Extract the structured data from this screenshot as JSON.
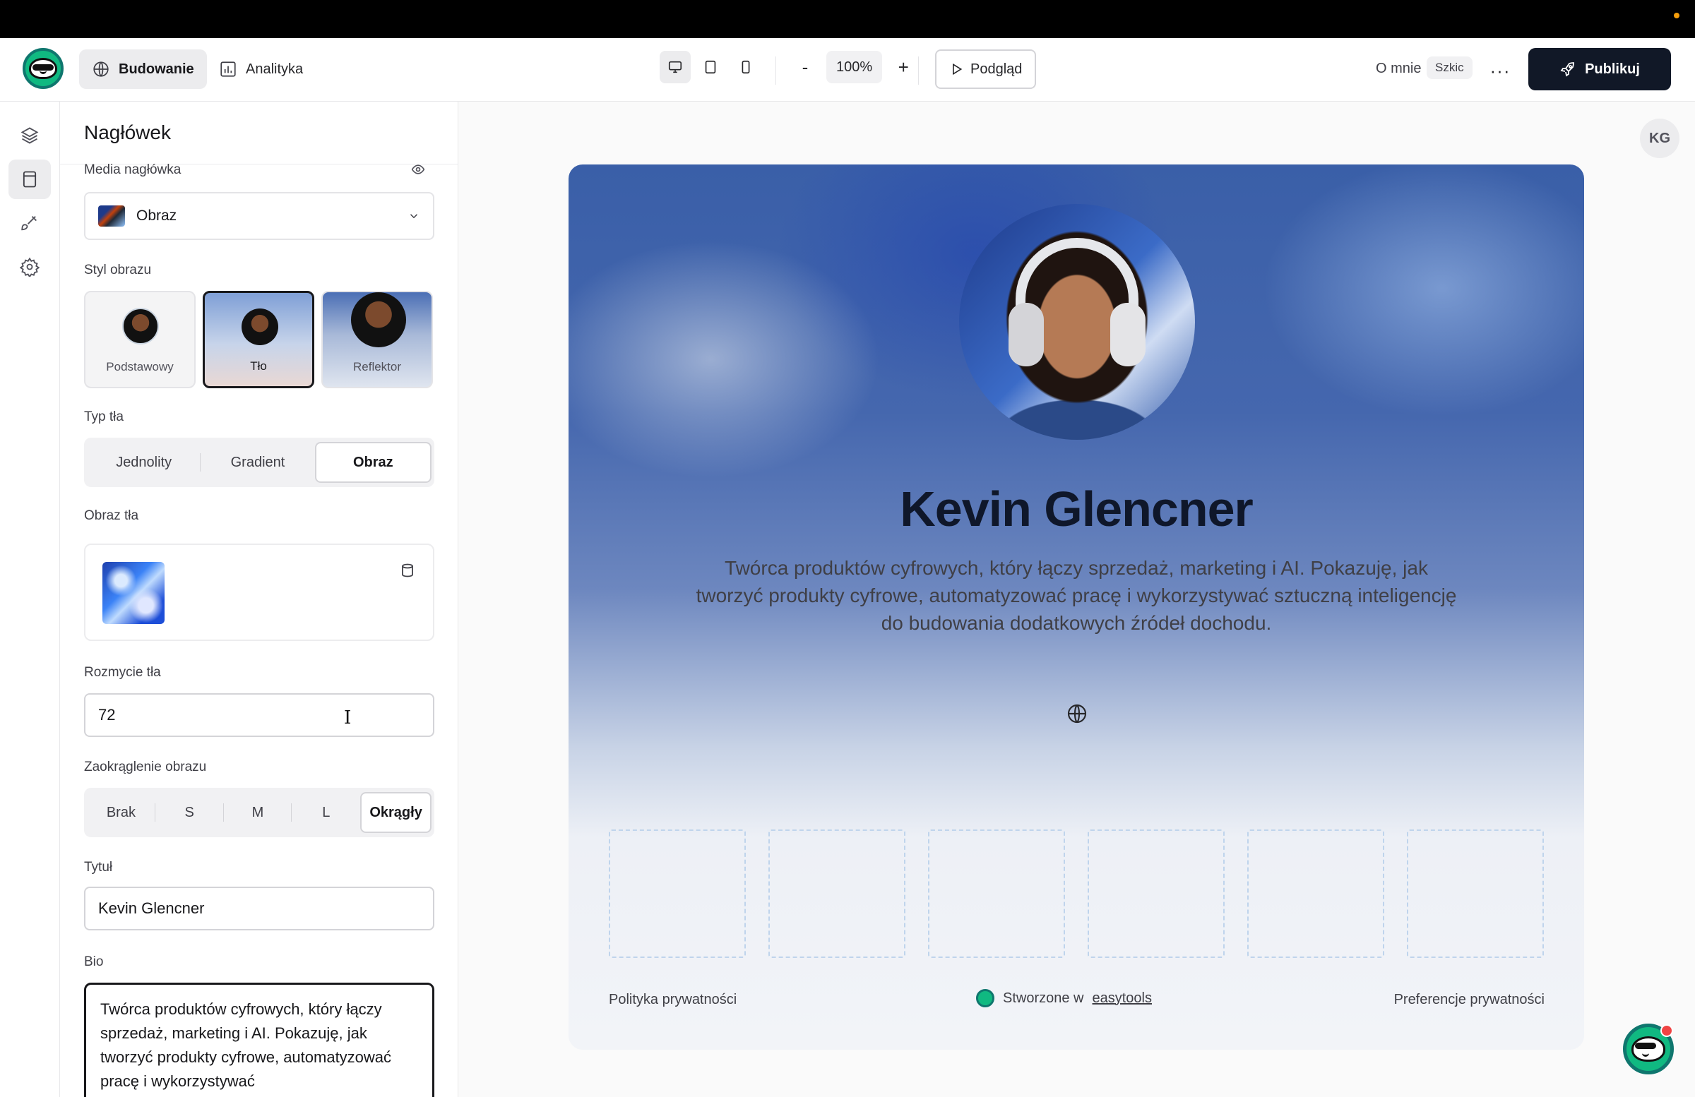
{
  "header": {
    "tabs": [
      {
        "label": "Budowanie",
        "icon": "globe-icon",
        "active": true
      },
      {
        "label": "Analityka",
        "icon": "chart-icon",
        "active": false
      }
    ],
    "devices": [
      "desktop-icon",
      "tablet-icon",
      "mobile-icon"
    ],
    "zoom": {
      "minus": "-",
      "value": "100%",
      "plus": "+"
    },
    "preview_label": "Podgląd",
    "page_name": "O mnie",
    "draft_badge": "Szkic",
    "more_label": "···",
    "publish_label": "Publikuj"
  },
  "rail": {
    "items": [
      "layers-icon",
      "sections-icon",
      "brush-icon",
      "settings-icon"
    ]
  },
  "panel": {
    "title": "Nagłówek",
    "media_label": "Media nagłówka",
    "media_value": "Obraz",
    "image_style_label": "Styl obrazu",
    "image_styles": [
      {
        "label": "Podstawowy",
        "active": false
      },
      {
        "label": "Tło",
        "active": true
      },
      {
        "label": "Reflektor",
        "active": false
      }
    ],
    "bg_type_label": "Typ tła",
    "bg_types": [
      {
        "label": "Jednolity",
        "active": false
      },
      {
        "label": "Gradient",
        "active": false
      },
      {
        "label": "Obraz",
        "active": true
      }
    ],
    "bg_image_label": "Obraz tła",
    "blur_label": "Rozmycie tła",
    "blur_value": "72",
    "rounding_label": "Zaokrąglenie obrazu",
    "roundings": [
      {
        "label": "Brak",
        "active": false
      },
      {
        "label": "S",
        "active": false
      },
      {
        "label": "M",
        "active": false
      },
      {
        "label": "L",
        "active": false
      },
      {
        "label": "Okrągły",
        "active": true
      }
    ],
    "title_label": "Tytuł",
    "title_value": "Kevin Glencner",
    "bio_label": "Bio",
    "bio_value": "Twórca produktów cyfrowych, który łączy sprzedaż, marketing i AI. Pokazuję, jak tworzyć produkty cyfrowe, automatyzować pracę i wykorzystywać"
  },
  "canvas": {
    "user_initials": "KG",
    "hero": {
      "name": "Kevin Glencner",
      "bio": "Twórca produktów cyfrowych, który łączy sprzedaż, marketing i AI. Pokazuję, jak tworzyć produkty cyfrowe, automatyzować pracę i wykorzystywać sztuczną inteligencję do budowania dodatkowych źródeł dochodu."
    },
    "footer": {
      "privacy_policy": "Polityka prywatności",
      "made_with_prefix": "Stworzone w",
      "made_with_link": "easytools",
      "privacy_prefs": "Preferencje prywatności"
    }
  },
  "colors": {
    "accent": "#111827",
    "brand_green": "#10b981",
    "hero_blue": "#3a5fa8"
  }
}
